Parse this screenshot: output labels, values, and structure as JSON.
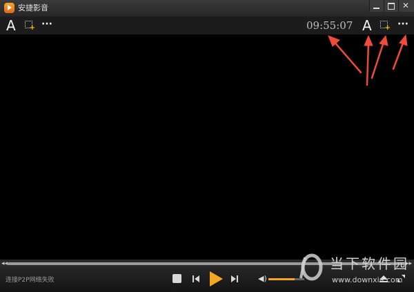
{
  "window": {
    "title": "安捷影音",
    "logo_icon": "orange-play-logo",
    "controls": {
      "minimize_icon": "minimize-icon",
      "maximize_icon": "maximize-icon",
      "close_icon": "close-icon"
    }
  },
  "osd": {
    "font_label": "A",
    "more_label": "···",
    "clock": "09:55:07",
    "screenshot_icon": "screenshot-icon"
  },
  "annotation": {
    "arrow_color": "#f04a3a"
  },
  "controlbar": {
    "status": "连接P2P网络失败",
    "accent_color": "#f5a623",
    "volume_level": 0.73
  },
  "watermark": {
    "text": "当下软件园",
    "url": "www.downxia.com"
  }
}
